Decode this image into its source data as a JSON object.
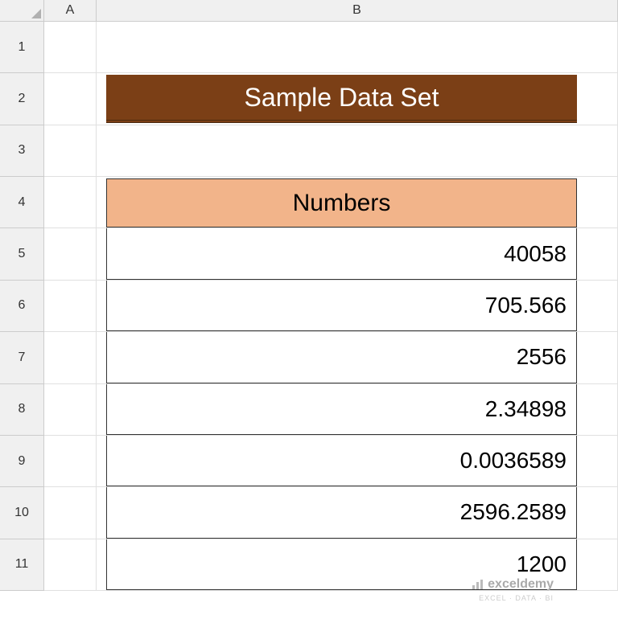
{
  "columns": [
    "A",
    "B"
  ],
  "rows": [
    "1",
    "2",
    "3",
    "4",
    "5",
    "6",
    "7",
    "8",
    "9",
    "10",
    "11"
  ],
  "title": "Sample Data Set",
  "table_header": "Numbers",
  "data": [
    "40058",
    "705.566",
    "2556",
    "2.34898",
    "0.0036589",
    "2596.2589",
    "1200"
  ],
  "watermark": {
    "brand": "exceldemy",
    "tag": "EXCEL · DATA · BI"
  },
  "chart_data": {
    "type": "table",
    "title": "Sample Data Set",
    "columns": [
      "Numbers"
    ],
    "rows": [
      [
        40058
      ],
      [
        705.566
      ],
      [
        2556
      ],
      [
        2.34898
      ],
      [
        0.0036589
      ],
      [
        2596.2589
      ],
      [
        1200
      ]
    ]
  }
}
